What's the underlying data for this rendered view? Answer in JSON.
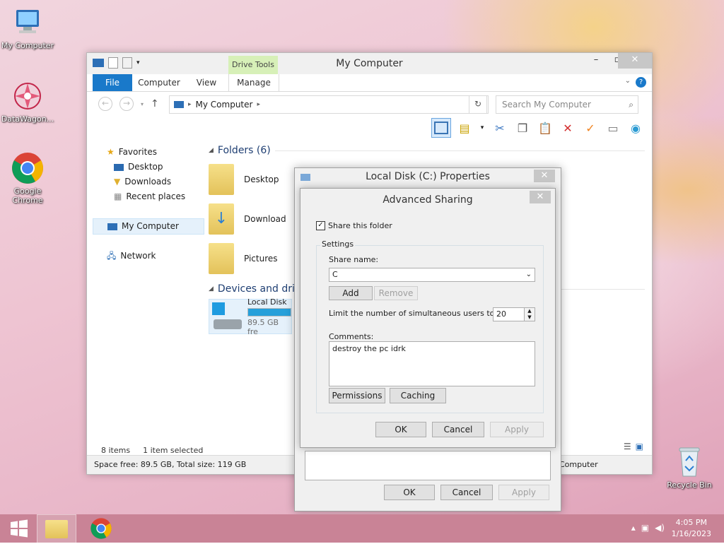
{
  "desktop": {
    "icons": [
      {
        "label": "My Computer"
      },
      {
        "label": "DataWagon..."
      },
      {
        "label": "Google Chrome"
      },
      {
        "label": "Recycle Bin"
      }
    ]
  },
  "explorer": {
    "title": "My Computer",
    "drive_tools": "Drive Tools",
    "tabs": {
      "file": "File",
      "computer": "Computer",
      "view": "View",
      "manage": "Manage"
    },
    "address": "My Computer",
    "search_placeholder": "Search My Computer",
    "nav": {
      "favorites": "Favorites",
      "desktop": "Desktop",
      "downloads": "Downloads",
      "recent": "Recent places",
      "my_computer": "My Computer",
      "network": "Network"
    },
    "folders_header": "Folders (6)",
    "folders": [
      "Desktop",
      "Download",
      "Pictures"
    ],
    "devices_header": "Devices and driv",
    "drive": {
      "name": "Local Disk",
      "free": "89.5 GB fre",
      "used_fraction": 0.25
    },
    "status_items": "8 items",
    "status_selected": "1 item selected",
    "details": "Space free: 89.5 GB, Total size: 119 GB",
    "details_right": "Computer"
  },
  "properties": {
    "title": "Local Disk (C:) Properties",
    "ok": "OK",
    "cancel": "Cancel",
    "apply": "Apply"
  },
  "advanced_sharing": {
    "title": "Advanced Sharing",
    "share_checkbox": "Share this folder",
    "share_checked": true,
    "settings": "Settings",
    "share_name_label": "Share name:",
    "share_name": "C",
    "add": "Add",
    "remove": "Remove",
    "limit_label": "Limit the number of simultaneous users to:",
    "limit_value": "20",
    "comments_label": "Comments:",
    "comments": "destroy the pc idrk",
    "permissions": "Permissions",
    "caching": "Caching",
    "ok": "OK",
    "cancel": "Cancel",
    "apply": "Apply"
  },
  "taskbar": {
    "time": "4:05 PM",
    "date": "1/16/2023"
  }
}
